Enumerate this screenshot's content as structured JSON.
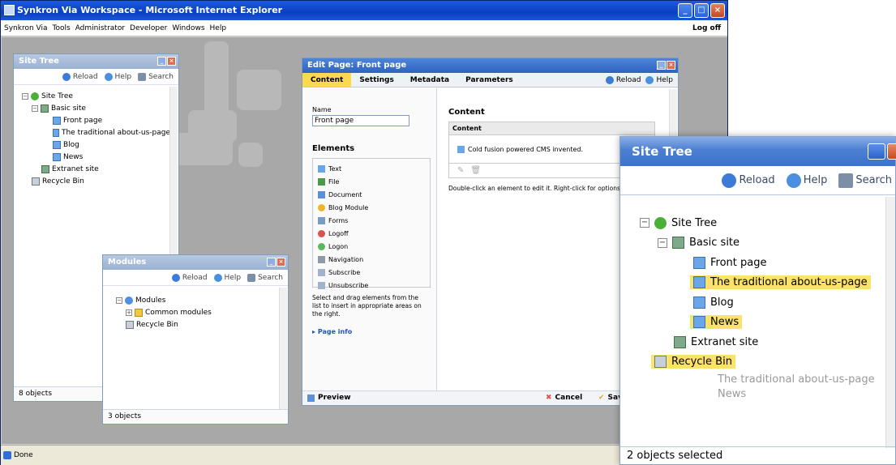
{
  "window": {
    "title": "Synkron Via Workspace - Microsoft Internet Explorer",
    "status": "Done"
  },
  "menu": {
    "items": [
      "Synkron Via",
      "Tools",
      "Administrator",
      "Developer",
      "Windows",
      "Help"
    ],
    "logoff": "Log off"
  },
  "site_tree": {
    "title": "Site Tree",
    "toolbar": {
      "reload": "Reload",
      "help": "Help",
      "search": "Search"
    },
    "nodes": {
      "root": "Site Tree",
      "basic": "Basic site",
      "front": "Front page",
      "about": "The traditional about-us-page",
      "blog": "Blog",
      "news": "News",
      "extranet": "Extranet site",
      "recycle": "Recycle Bin"
    },
    "status": "8 objects"
  },
  "modules": {
    "title": "Modules",
    "toolbar": {
      "reload": "Reload",
      "help": "Help",
      "search": "Search"
    },
    "nodes": {
      "root": "Modules",
      "common": "Common modules",
      "recycle": "Recycle Bin"
    },
    "status": "3 objects"
  },
  "edit_page": {
    "title": "Edit Page: Front page",
    "tabs": [
      "Content",
      "Settings",
      "Metadata",
      "Parameters"
    ],
    "toolbar": {
      "reload": "Reload",
      "help": "Help"
    },
    "name_label": "Name",
    "name_value": "Front page",
    "elements_heading": "Elements",
    "elements": [
      "Text",
      "File",
      "Document",
      "Blog Module",
      "Forms",
      "Logoff",
      "Logon",
      "Navigation",
      "Subscribe",
      "Unsubscribe"
    ],
    "elements_hint": "Select and drag elements from the list to insert in appropriate areas on the right.",
    "page_info": "Page info",
    "content_heading": "Content",
    "content_box_header": "Content",
    "content_item": "Cold fusion powered CMS invented.",
    "content_hint": "Double-click an element to edit it. Right-click for options.",
    "footer": {
      "preview": "Preview",
      "cancel": "Cancel",
      "save": "Save dr"
    }
  },
  "zoom": {
    "title": "Site Tree",
    "toolbar": {
      "reload": "Reload",
      "help": "Help",
      "search": "Search"
    },
    "nodes": {
      "root": "Site Tree",
      "basic": "Basic site",
      "front": "Front page",
      "about": "The traditional about-us-page",
      "blog": "Blog",
      "news": "News",
      "extranet": "Extranet site",
      "recycle": "Recycle Bin"
    },
    "drag_ghost": [
      "The traditional about-us-page",
      "News"
    ],
    "status": "2 objects selected"
  }
}
